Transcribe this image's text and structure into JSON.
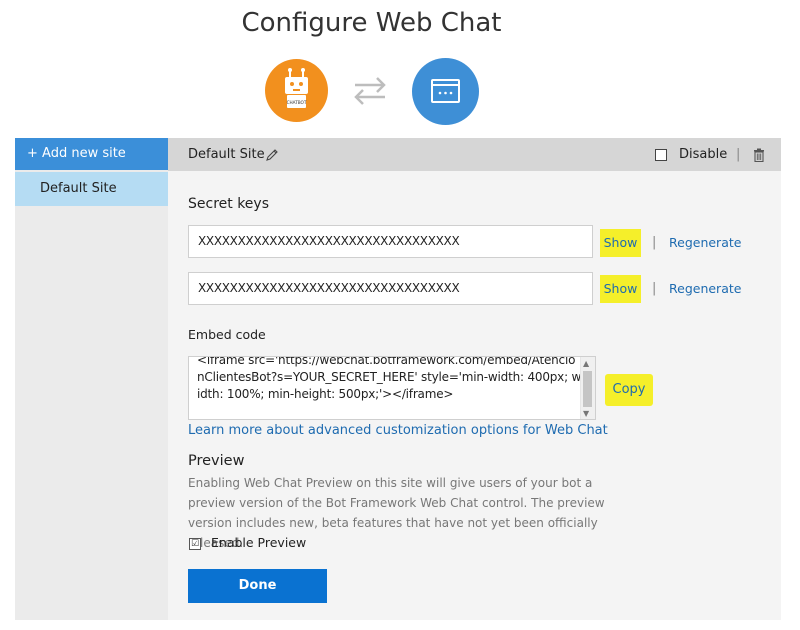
{
  "page": {
    "title": "Configure Web Chat"
  },
  "icons": {
    "bot": "robot-icon",
    "bot_badge": "CHATBOT",
    "swap": "swap-arrows-icon",
    "web": "browser-window-icon",
    "orange": "#f2901e",
    "blue": "#3e8fd6"
  },
  "sidebar": {
    "add_label": "+ Add new site",
    "items": [
      {
        "label": "Default Site"
      }
    ]
  },
  "header": {
    "site_name": "Default Site",
    "disable_label": "Disable",
    "separator": "|"
  },
  "secret_keys": {
    "title": "Secret keys",
    "keys": [
      {
        "value": "XXXXXXXXXXXXXXXXXXXXXXXXXXXXXXXXX",
        "show_label": "Show",
        "regenerate_label": "Regenerate"
      },
      {
        "value": "XXXXXXXXXXXXXXXXXXXXXXXXXXXXXXXXX",
        "show_label": "Show",
        "regenerate_label": "Regenerate"
      }
    ],
    "separator": "|"
  },
  "embed": {
    "label": "Embed code",
    "code": "<iframe src='https://webchat.botframework.com/embed/AtencionClientesBot?s=YOUR_SECRET_HERE'  style='min-width: 400px; width: 100%; min-height: 500px;'></iframe>",
    "copy_label": "Copy",
    "learn_more": "Learn more about advanced customization options for Web Chat"
  },
  "preview": {
    "title": "Preview",
    "description": "Enabling Web Chat Preview on this site will give users of your bot a preview version of the Bot Framework Web Chat control. The preview version includes new, beta features that have not yet been officially released.",
    "enable_label": "Enable Preview",
    "enable_checked": true,
    "check_mark": "☑"
  },
  "done_label": "Done",
  "colors": {
    "accent": "#0a72d1",
    "highlight": "#f5ef2a",
    "link": "#1e6bb0"
  }
}
